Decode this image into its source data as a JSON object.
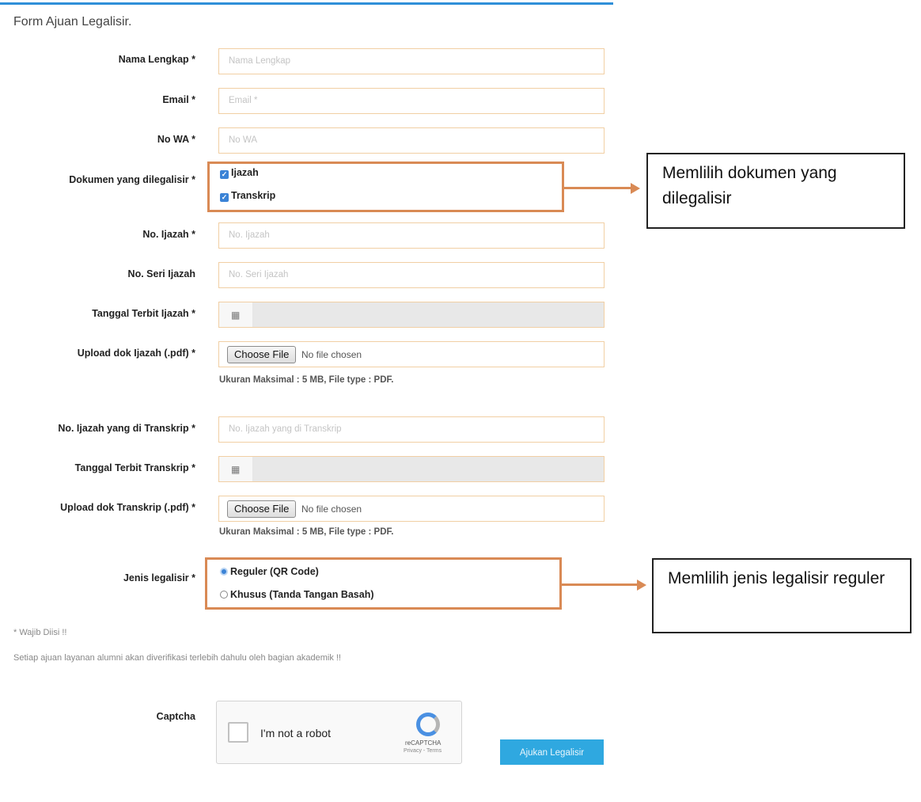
{
  "form_title": "Form Ajuan Legalisir.",
  "fields": {
    "nama": {
      "label": "Nama Lengkap *",
      "placeholder": "Nama Lengkap"
    },
    "email": {
      "label": "Email *",
      "placeholder": "Email *"
    },
    "wa": {
      "label": "No WA *",
      "placeholder": "No WA"
    },
    "dokumen": {
      "label": "Dokumen yang dilegalisir *",
      "options": [
        {
          "label": "Ijazah",
          "checked": true
        },
        {
          "label": "Transkrip",
          "checked": true
        }
      ]
    },
    "no_ijazah": {
      "label": "No. Ijazah *",
      "placeholder": "No. Ijazah"
    },
    "no_seri": {
      "label": "No. Seri Ijazah",
      "placeholder": "No. Seri Ijazah"
    },
    "tgl_ijazah": {
      "label": "Tanggal Terbit Ijazah *",
      "icon": "calendar-icon"
    },
    "upload_ijazah": {
      "label": "Upload dok Ijazah (.pdf) *",
      "button": "Choose File",
      "status": "No file chosen",
      "hint": "Ukuran Maksimal : 5 MB, File type : PDF."
    },
    "no_ijazah_transkrip": {
      "label": "No. Ijazah yang di Transkrip *",
      "placeholder": "No. Ijazah yang di Transkrip"
    },
    "tgl_transkrip": {
      "label": "Tanggal Terbit Transkrip *",
      "icon": "calendar-icon"
    },
    "upload_transkrip": {
      "label": "Upload dok Transkrip (.pdf) *",
      "button": "Choose File",
      "status": "No file chosen",
      "hint": "Ukuran Maksimal : 5 MB, File type : PDF."
    },
    "jenis": {
      "label": "Jenis legalisir *",
      "options": [
        {
          "label": "Reguler (QR Code)",
          "selected": true
        },
        {
          "label": "Khusus (Tanda Tangan Basah)",
          "selected": false
        }
      ]
    }
  },
  "notes": {
    "required": "* Wajib Diisi !!",
    "verification": "Setiap ajuan layanan alumni akan diverifikasi terlebih dahulu oleh bagian akademik !!"
  },
  "captcha": {
    "label": "Captcha",
    "text": "I'm not a robot",
    "brand": "reCAPTCHA",
    "links": "Privacy - Terms"
  },
  "submit_label": "Ajukan Legalisir",
  "annotations": {
    "dokumen_callout": "Memlilih dokumen yang dilegalisir",
    "jenis_callout": "Memlilih jenis legalisir reguler"
  },
  "colors": {
    "accent": "#2fa8e0",
    "highlight": "#d98a55",
    "field_border": "#f1cfa4"
  }
}
